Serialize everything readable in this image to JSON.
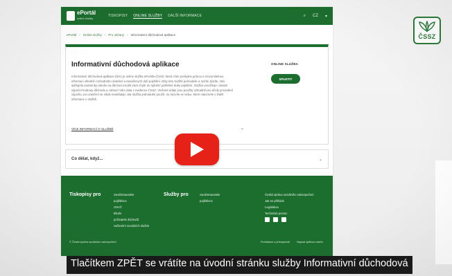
{
  "portal": {
    "brand_title": "ePortál",
    "brand_subtitle": "online služby",
    "nav": [
      "TISKOPISY",
      "ONLINE SLUŽBY",
      "DALŠÍ INFORMACE"
    ],
    "active_index": 1,
    "search_icon": "search-icon",
    "lang": "CZ",
    "menu_icon": "chevron-down-icon"
  },
  "breadcrumb": [
    "ePortál",
    "Online služby",
    "Pro občany",
    "Informativní důchodová aplikace"
  ],
  "hero": {
    "title": "Informativní důchodová aplikace",
    "body": "Informativní důchodová aplikace (IDA) je online služba ePortálu ČSSZ, která Vám poskytne jednou a srozumitelnou informaci ohledně rozhodného obdobní a dosažených dob pojištění. Díky této službě jednoduše a rychle zjistíte, zda splňujete podmínky nároku na důchod a kolik Vám chybí do splnění potřebné doby pojištění. Služba umožňuje i vlastní výpočet hodnoty důchodu a zobrazí Vám data z evidence ČSSZ. Vložené údaje jsou použity výhradně pro účely provedení výpočtu, po uzavření se nikde neukládají. Jak služba jednoduše použít, se dozvíte ve videu, které naleznete v Další informace o službě.",
    "more": "VÍCE INFORMACÍ O SLUŽBĚ",
    "chev": "⌄"
  },
  "side": {
    "label": "ONLINE SLUŽBA",
    "button": "SPUSTIT"
  },
  "accordion": {
    "title": "Co dělat, když...",
    "chev": "⌄"
  },
  "footer": {
    "col1_title": "Tiskopisy pro",
    "col1_items": [
      "zaměstnavatele",
      "pojištěnce",
      "OSVČ",
      "lékaře",
      "poživatele důchodů",
      "začlenění sociálních služeb"
    ],
    "col2_title": "Služby pro",
    "col2_items": [
      "zaměstnavatele",
      "pojištěnce"
    ],
    "col3_items": [
      "Česká správa sociálního zabezpečení",
      "Jak se přihlásit",
      "Legislativa",
      "Technická pomoc"
    ],
    "copyright": "© Česká správa sociálního zabezpečení",
    "bottom_links": [
      "Prohlášení o přístupnosti",
      "Napsat zpětnou vazbu"
    ]
  },
  "logo_text": "ČSSZ",
  "caption": "Tlačítkem ZPĚT se vrátíte na úvodní stránku služby Informativní důchodová",
  "colors": {
    "brand_green": "#1c6e2f",
    "youtube_red": "#e62117"
  }
}
